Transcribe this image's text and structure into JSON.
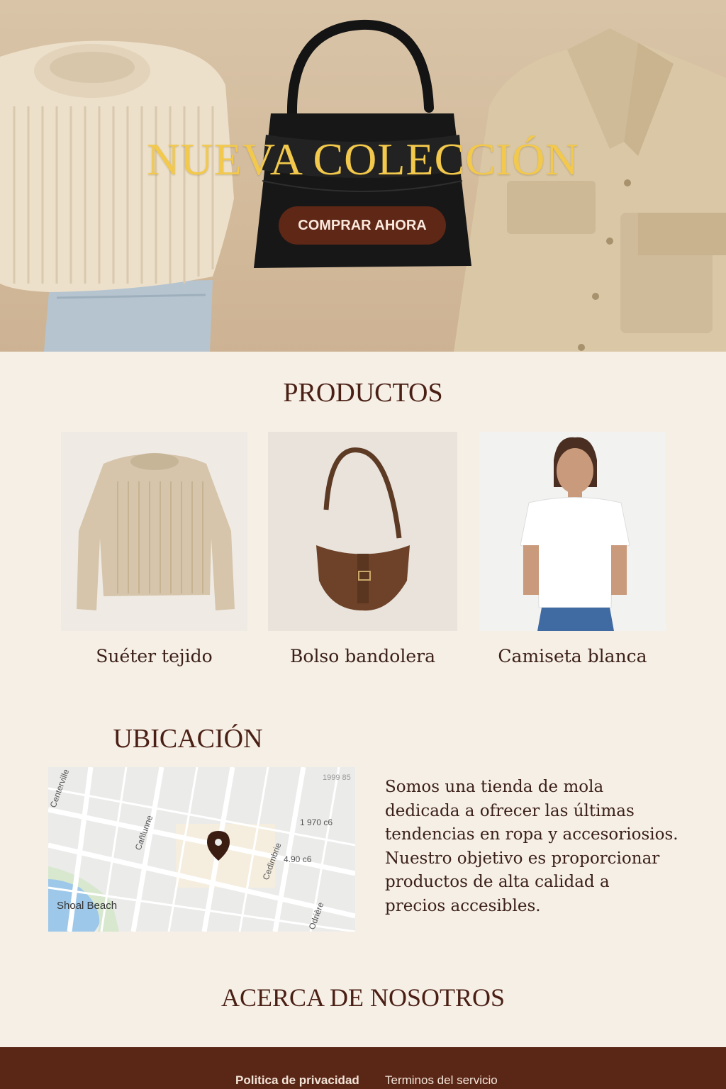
{
  "hero": {
    "title": "NUEVA COLECCIÓN",
    "cta_label": "COMPRAR AHORA"
  },
  "products": {
    "title": "PRODUCTOS",
    "items": [
      {
        "name": "Suéter tejido"
      },
      {
        "name": "Bolso bandolera"
      },
      {
        "name": "Camiseta blanca"
      }
    ]
  },
  "location": {
    "title": "UBICACIÓN",
    "map_labels": {
      "area": "Shoal Beach",
      "street_1": "Centerville",
      "street_2": "Cañlunne",
      "street_3": "Cedimbrie",
      "street_4": "Odrière",
      "num_1": "1999 85",
      "num_2": "1 970 ᴄ6",
      "num_3": "4.90 ᴄ6"
    },
    "about_lines": [
      "Somos una tienda de mola",
      "dedicada a ofrecer las últimas",
      "tendencias en ropa y accesoriosios.",
      "Nuestro objetivo es proporcionar",
      "productos de alta calidad a",
      "precios accesibles."
    ]
  },
  "about": {
    "title": "ACERCA DE NOSOTROS"
  },
  "footer": {
    "privacy": "Politica de privacidad",
    "terms": "Terminos del servicio"
  },
  "colors": {
    "accent": "#5e2716",
    "title_gold": "#f2c94c",
    "background": "#f6efe6"
  }
}
